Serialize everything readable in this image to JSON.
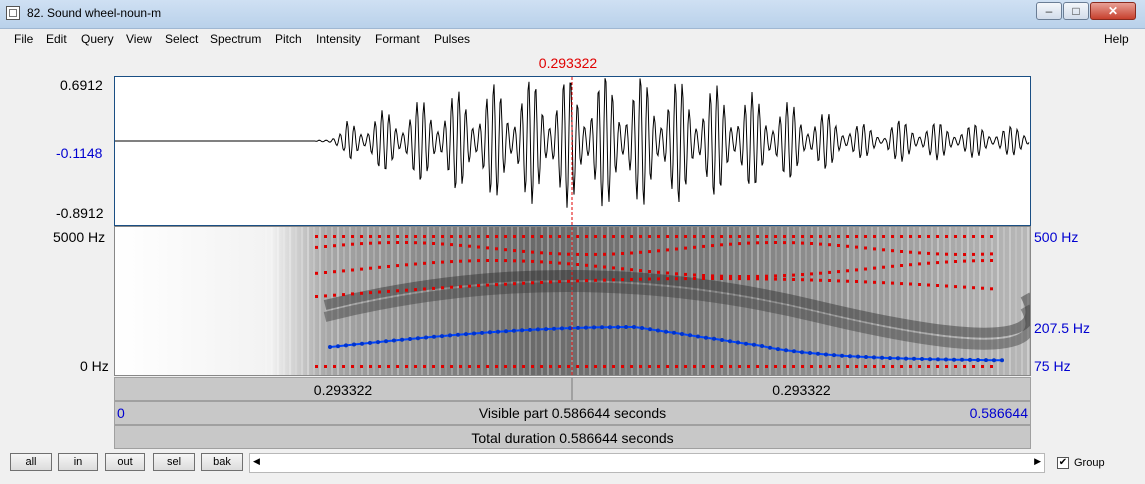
{
  "window": {
    "title": "82. Sound wheel-noun-m",
    "min_icon": "minimize-icon",
    "max_icon": "maximize-icon",
    "close_icon": "close-icon",
    "min_glyph": "–",
    "max_glyph": "□",
    "close_glyph": "✕"
  },
  "menu": {
    "items": [
      "File",
      "Edit",
      "Query",
      "View",
      "Select",
      "Spectrum",
      "Pitch",
      "Intensity",
      "Formant",
      "Pulses"
    ],
    "help": "Help"
  },
  "editor": {
    "cursor_time": "0.293322",
    "waveform": {
      "max": "0.6912",
      "mid": "-0.1148",
      "min": "-0.8912"
    },
    "spectrogram": {
      "top": "5000 Hz",
      "bottom": "0 Hz"
    },
    "pitch": {
      "top": "500 Hz",
      "mid": "207.5 Hz",
      "bottom": "75 Hz"
    },
    "selection": {
      "left": "0.293322",
      "right": "0.293322"
    },
    "visible": {
      "start": "0",
      "label": "Visible part 0.586644 seconds",
      "end": "0.586644"
    },
    "total": "Total duration 0.586644 seconds",
    "colors": {
      "cursor": "#e00000",
      "pitch": "#0000d0",
      "formant": "#e00000"
    }
  },
  "bottom": {
    "buttons": [
      "all",
      "in",
      "out",
      "sel",
      "bak"
    ],
    "scroll_left": "◀",
    "scroll_right": "▶",
    "group_label": "Group",
    "group_checked": true,
    "check_glyph": "✔"
  }
}
